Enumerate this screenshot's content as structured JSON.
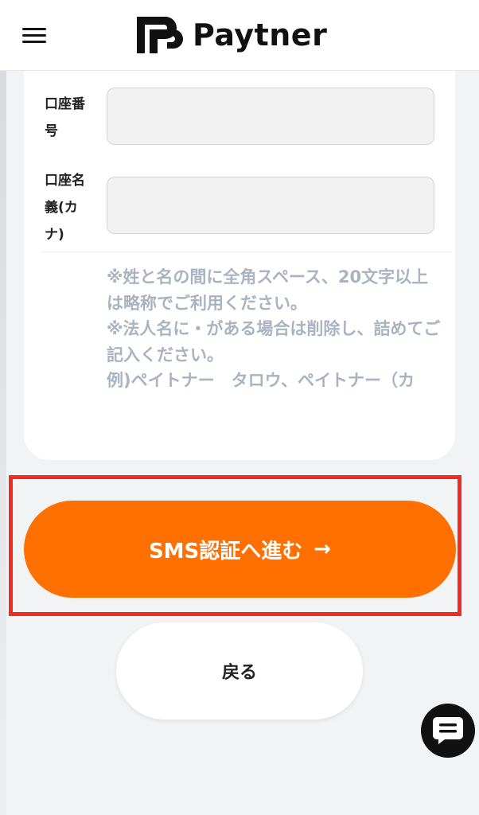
{
  "header": {
    "brand_name": "Paytner",
    "menu_icon": "hamburger-menu-icon",
    "logo_icon": "paytner-logo-icon"
  },
  "form": {
    "account_number_label_line1": "口座番",
    "account_number_label_line2": "号",
    "account_number_value": "",
    "account_name_label_line1": "口座名",
    "account_name_label_line2": "義(カ",
    "account_name_label_line3": "ナ)",
    "account_name_value": "",
    "note_lines": [
      "※姓と名の間に全角スペース、20文字以上は略称でご利用ください。",
      "※法人名に・がある場合は削除し、詰めてご記入ください。",
      "例)ペイトナー　タロウ、ペイトナー（カ"
    ]
  },
  "actions": {
    "sms_button_label": "SMS認証へ進む",
    "sms_button_arrow": "→",
    "back_button_label": "戻る"
  },
  "chat": {
    "icon": "chat-bubble-icon"
  },
  "colors": {
    "accent": "#ff7000",
    "highlight_border": "#ee2d20",
    "note_text": "#aab3c1",
    "background": "#f2f3f5"
  }
}
